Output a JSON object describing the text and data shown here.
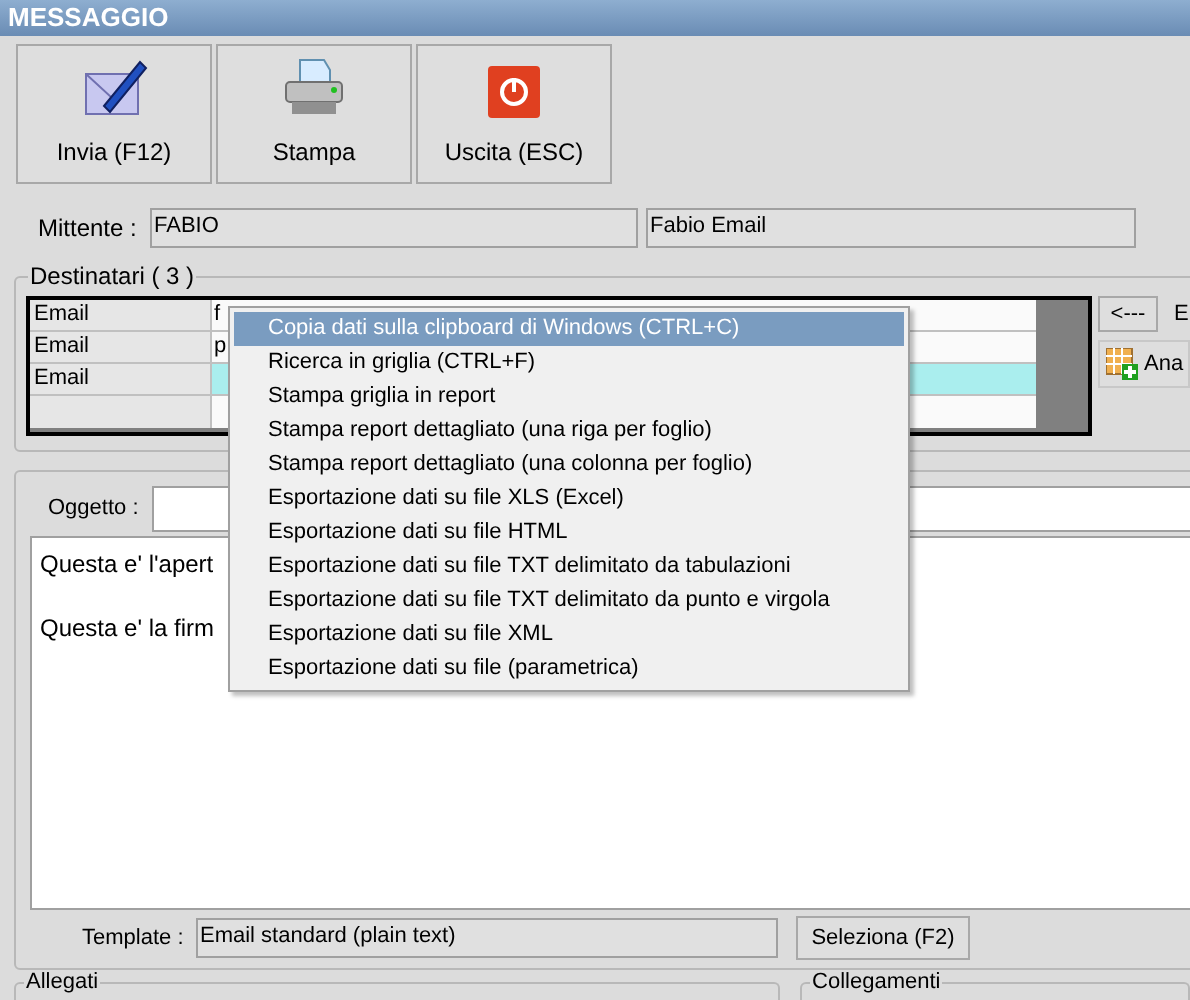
{
  "window": {
    "title": "MESSAGGIO"
  },
  "toolbar": [
    {
      "kind": "send",
      "label": "Invia (F12)"
    },
    {
      "kind": "print",
      "label": "Stampa"
    },
    {
      "kind": "exit",
      "label": "Uscita (ESC)"
    }
  ],
  "sender": {
    "label": "Mittente :",
    "value": "FABIO",
    "display_name": "Fabio Email"
  },
  "recipients": {
    "title": "Destinatari ( 3 )",
    "rows": [
      {
        "type": "Email",
        "address": "f",
        "selected": false
      },
      {
        "type": "Email",
        "address": "p",
        "selected": false
      },
      {
        "type": "Email",
        "selected": true
      }
    ],
    "side_buttons": [
      {
        "kind": "arrow",
        "label": "<---",
        "caption": "E"
      },
      {
        "kind": "grid",
        "label": "Ana"
      }
    ]
  },
  "subject": {
    "label": "Oggetto :"
  },
  "body": [
    "Questa e' l'apert",
    "Questa e' la firm"
  ],
  "template": {
    "label": "Template :",
    "value": "Email standard (plain text)",
    "button": "Seleziona (F2)"
  },
  "groups": [
    "Allegati",
    "Collegamenti"
  ],
  "context_menu": [
    {
      "label": "Copia dati sulla clipboard di Windows (CTRL+C)",
      "selected": true
    },
    {
      "label": "Ricerca in griglia (CTRL+F)",
      "selected": false
    },
    {
      "label": "Stampa griglia in report",
      "selected": false
    },
    {
      "label": "Stampa report dettagliato (una riga per foglio)",
      "selected": false
    },
    {
      "label": "Stampa report dettagliato (una colonna per foglio)",
      "selected": false
    },
    {
      "label": "Esportazione dati su file XLS (Excel)",
      "selected": false
    },
    {
      "label": "Esportazione dati su file HTML",
      "selected": false
    },
    {
      "label": "Esportazione dati su file TXT delimitato da tabulazioni",
      "selected": false
    },
    {
      "label": "Esportazione dati su file TXT delimitato da punto e virgola",
      "selected": false
    },
    {
      "label": "Esportazione dati su file XML",
      "selected": false
    },
    {
      "label": "Esportazione dati su file (parametrica)",
      "selected": false
    }
  ]
}
